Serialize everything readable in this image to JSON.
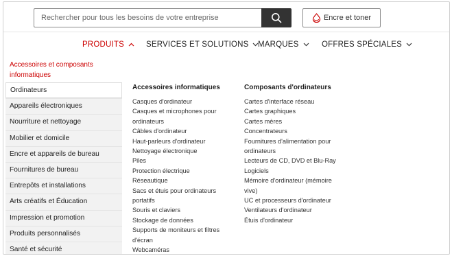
{
  "search": {
    "placeholder": "Rechercher pour tous les besoins de votre entreprise"
  },
  "ink_button": {
    "label": "Encre et toner"
  },
  "colors": {
    "accent": "#cc0000",
    "search_button": "#333333",
    "sidebar_bg": "#f2f2f2"
  },
  "icons": {
    "search": "search-icon",
    "ink": "ink-drop-icon",
    "chevron_up": "chevron-up-icon",
    "chevron_down": "chevron-down-icon"
  },
  "nav": {
    "items": [
      {
        "label": "PRODUITS",
        "state": "expanded"
      },
      {
        "label": "SERVICES ET SOLUTIONS",
        "state": "collapsed"
      },
      {
        "label": "MARQUES",
        "state": "collapsed"
      },
      {
        "label": "OFFRES SPÉCIALES",
        "state": "collapsed"
      }
    ]
  },
  "sidebar": {
    "heading": "Accessoires et composants informatiques",
    "items": [
      "Ordinateurs",
      "Appareils électroniques",
      "Nourriture et nettoyage",
      "Mobilier et domicile",
      "Encre et appareils de bureau",
      "Fournitures de bureau",
      "Entrepôts et installations",
      "Arts créatifs et Éducation",
      "Impression et promotion",
      "Produits personnalisés",
      "Santé et sécurité"
    ]
  },
  "columns": [
    {
      "title": "Accessoires informatiques",
      "lines": [
        "Casques d'ordinateur",
        "Casques et microphones pour",
        "ordinateurs",
        "Câbles d'ordinateur",
        "Haut-parleurs d'ordinateur",
        "Nettoyage électronique",
        "Piles",
        "Protection électrique",
        "Réseautique",
        "Sacs et étuis pour ordinateurs",
        "portatifs",
        "Souris et claviers",
        "Stockage de données",
        "Supports de moniteurs et filtres",
        "d'écran",
        "Webcaméras"
      ]
    },
    {
      "title": "Composants d'ordinateurs",
      "lines": [
        "Cartes d'interface réseau",
        "Cartes graphiques",
        "Cartes mères",
        "Concentrateurs",
        "Fournitures d'alimentation pour",
        "ordinateurs",
        "Lecteurs de CD, DVD et Blu-Ray",
        "Logiciels",
        "Mémoire d'ordinateur (mémoire",
        "vive)",
        "UC et processeurs d'ordinateur",
        "Ventilateurs d'ordinateur",
        "Étuis d'ordinateur"
      ]
    }
  ]
}
